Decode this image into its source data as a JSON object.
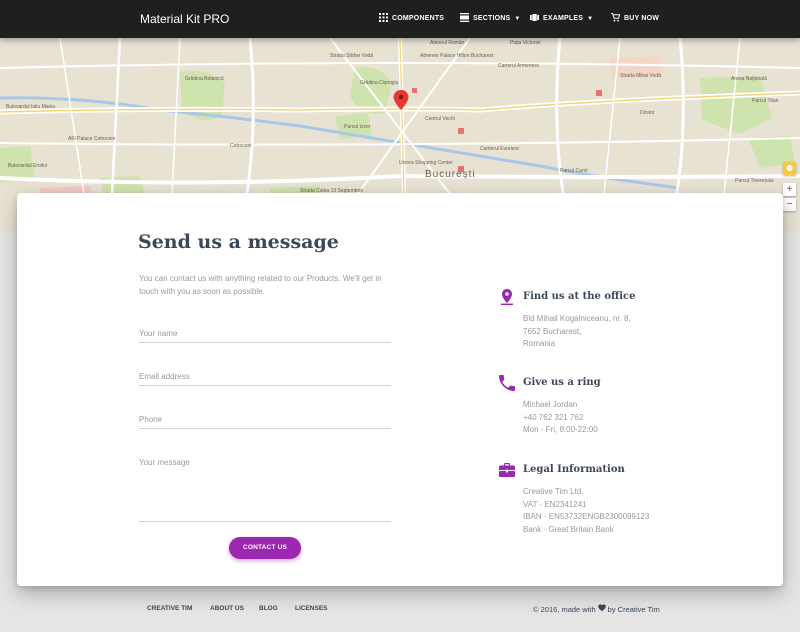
{
  "nav": {
    "brand": "Material Kit PRO",
    "items": [
      {
        "label": "Components",
        "icon": "apps-grid-icon"
      },
      {
        "label": "Sections",
        "icon": "view-day-icon"
      },
      {
        "label": "Examples",
        "icon": "view-carousel-icon"
      },
      {
        "label": "Buy Now",
        "icon": "shopping-cart-icon"
      }
    ]
  },
  "map": {
    "city": "București",
    "labels": [
      "Bulevardul Iuliu Maniu",
      "AFI Palace Cotroceni",
      "Bulevardul Eroilor",
      "Grădina Botanică",
      "Cotroceni",
      "Grădina Cișmigiu",
      "Parcul Izvor",
      "Centrul Vechi",
      "Unirea Shopping Center",
      "Athenee Palace Hilton Bucharest",
      "Ateneul Român",
      "Strada Știrbei Vodă",
      "Carterul Armenesc",
      "Arena Națională",
      "Parcul Titan",
      "Parcul Tineretului",
      "Strada Calea 13 Septembrie",
      "Cartierul Evreiesc",
      "Parcul Carol",
      "Piața Victoriei",
      "Strada Mihai Vodă",
      "Dristor"
    ],
    "accent": "#e53935"
  },
  "contact": {
    "title": "Send us a message",
    "description": "You can contact us with anything related to our Products. We'll get in touch with you as soon as possible.",
    "fields": {
      "name": "Your name",
      "email": "Email address",
      "phone": "Phone",
      "message": "Your message"
    },
    "button": "Contact Us",
    "accent": "#9c27b0"
  },
  "info": [
    {
      "title": "Find us at the office",
      "icon": "pin-drop-icon",
      "lines": [
        "Bld Mihail Kogalniceanu, nr. 8,",
        "7652 Bucharest,",
        "Romania"
      ]
    },
    {
      "title": "Give us a ring",
      "icon": "phone-icon",
      "lines": [
        "Michael Jordan",
        "+40 762 321 762",
        "Mon - Fri, 8:00-22:00"
      ]
    },
    {
      "title": "Legal Information",
      "icon": "business-center-icon",
      "lines": [
        "Creative Tim Ltd.",
        "VAT · EN2341241",
        "IBAN · EN53732ENGB2300099123",
        "Bank · Great Britain Bank"
      ]
    }
  ],
  "footer": {
    "links": [
      "Creative Tim",
      "About Us",
      "Blog",
      "Licenses"
    ],
    "copyright_prefix": "© 2016, made with",
    "copyright_suffix": "by Creative Tim",
    "heart_icon": "heart-icon"
  }
}
